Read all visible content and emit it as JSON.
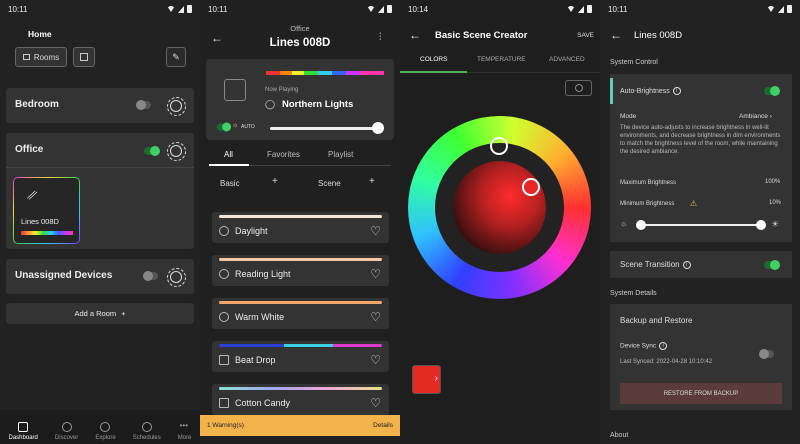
{
  "status": {
    "time1": "10:11",
    "time2": "10:11",
    "time3": "10:14",
    "time4": "10:11"
  },
  "home": {
    "title": "Home",
    "rooms_chip": "Rooms",
    "rooms": [
      {
        "name": "Bedroom",
        "on": false
      },
      {
        "name": "Office",
        "on": true
      },
      {
        "name": "Unassigned Devices",
        "on": false
      }
    ],
    "device_card": {
      "name": "Lines 008D"
    },
    "add_room": "Add a Room",
    "add_plus": "+",
    "nav": [
      "Dashboard",
      "Discover",
      "Explore",
      "Schedules",
      "More"
    ]
  },
  "device": {
    "room": "Office",
    "title": "Lines 008D",
    "now_playing_label": "Now Playing",
    "now_playing": "Northern Lights",
    "auto_label": "AUTO",
    "brightness_fraction": 0.95,
    "tabs": [
      "All",
      "Favorites",
      "Playlist"
    ],
    "basic_label": "Basic",
    "scene_label": "Scene",
    "plus": "+",
    "scenes": [
      {
        "name": "Daylight",
        "color": "#f4e6d6"
      },
      {
        "name": "Reading Light",
        "color": "#f5c6a0"
      },
      {
        "name": "Warm White",
        "color": "#f2a86a"
      },
      {
        "name": "Beat Drop",
        "color": "multicolor"
      },
      {
        "name": "Cotton Candy",
        "color": "pastel"
      }
    ],
    "warning": "1 Warning(s)",
    "details": "Details"
  },
  "creator": {
    "title": "Basic Scene Creator",
    "save": "SAVE",
    "tabs": [
      "COLORS",
      "TEMPERATURE",
      "ADVANCED"
    ],
    "selected_color": "#e32b24"
  },
  "settings": {
    "title": "Lines 008D",
    "system_control": "System Control",
    "auto_brightness": "Auto-Brightness",
    "mode_label": "Mode",
    "mode_value": "Ambiance",
    "description": "The device auto-adjusts to increase brightness in well-lit environments, and decrease brightness in dim environments to match the brightness level of the room, while maintaining the desired ambiance.",
    "max_brightness": "Maximum Brightness",
    "max_value": "100%",
    "min_brightness": "Minimum Brightness",
    "min_value": "10%",
    "scene_transition": "Scene Transition",
    "system_details": "System Details",
    "backup_title": "Backup and Restore",
    "device_sync": "Device Sync",
    "last_synced": "Last Synced: 2022-04-28 10:10:42",
    "restore_button": "RESTORE FROM BACKUP",
    "about_partial": "About"
  }
}
